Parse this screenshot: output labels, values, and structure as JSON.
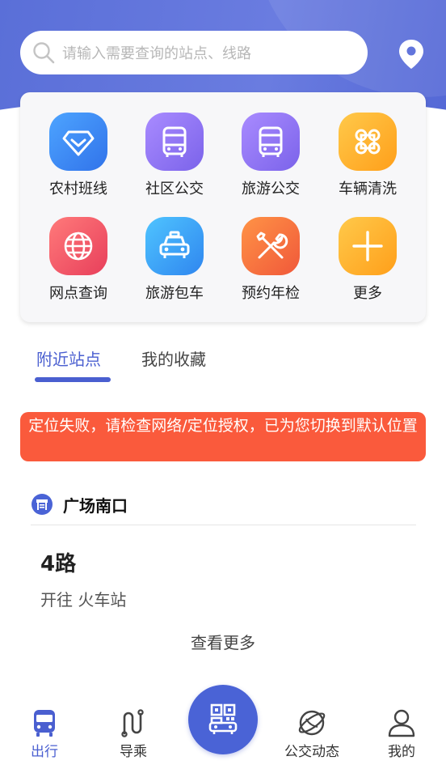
{
  "search": {
    "placeholder": "请输入需要查询的站点、线路"
  },
  "services": [
    {
      "label": "农村班线",
      "icon": "diamond-icon",
      "color": "#3b8ff2"
    },
    {
      "label": "社区公交",
      "icon": "bus-icon",
      "color": "#8b6ff0"
    },
    {
      "label": "旅游公交",
      "icon": "bus-icon",
      "color": "#8b6ff0"
    },
    {
      "label": "车辆清洗",
      "icon": "grid-four-icon",
      "color": "#ffb62e"
    },
    {
      "label": "网点查询",
      "icon": "globe-icon",
      "color": "#f45b66"
    },
    {
      "label": "旅游包车",
      "icon": "taxi-icon",
      "color": "#3b9cf2"
    },
    {
      "label": "预约年检",
      "icon": "tools-icon",
      "color": "#ff7040"
    },
    {
      "label": "更多",
      "icon": "plus-icon",
      "color": "#ffb62e"
    }
  ],
  "tabs": {
    "nearby": "附近站点",
    "favorites": "我的收藏"
  },
  "error_message": "定位失败，请检查网络/定位授权，已为您切换到默认位置",
  "station": {
    "name": "广场南口",
    "route": {
      "name": "4路",
      "direction": "开往  火车站"
    }
  },
  "see_more": "查看更多",
  "nav": {
    "trip": "出行",
    "guide": "导乘",
    "bus_news": "公交动态",
    "mine": "我的"
  },
  "colors": {
    "primary": "#4a5fd0",
    "error": "#fa5a3c"
  }
}
